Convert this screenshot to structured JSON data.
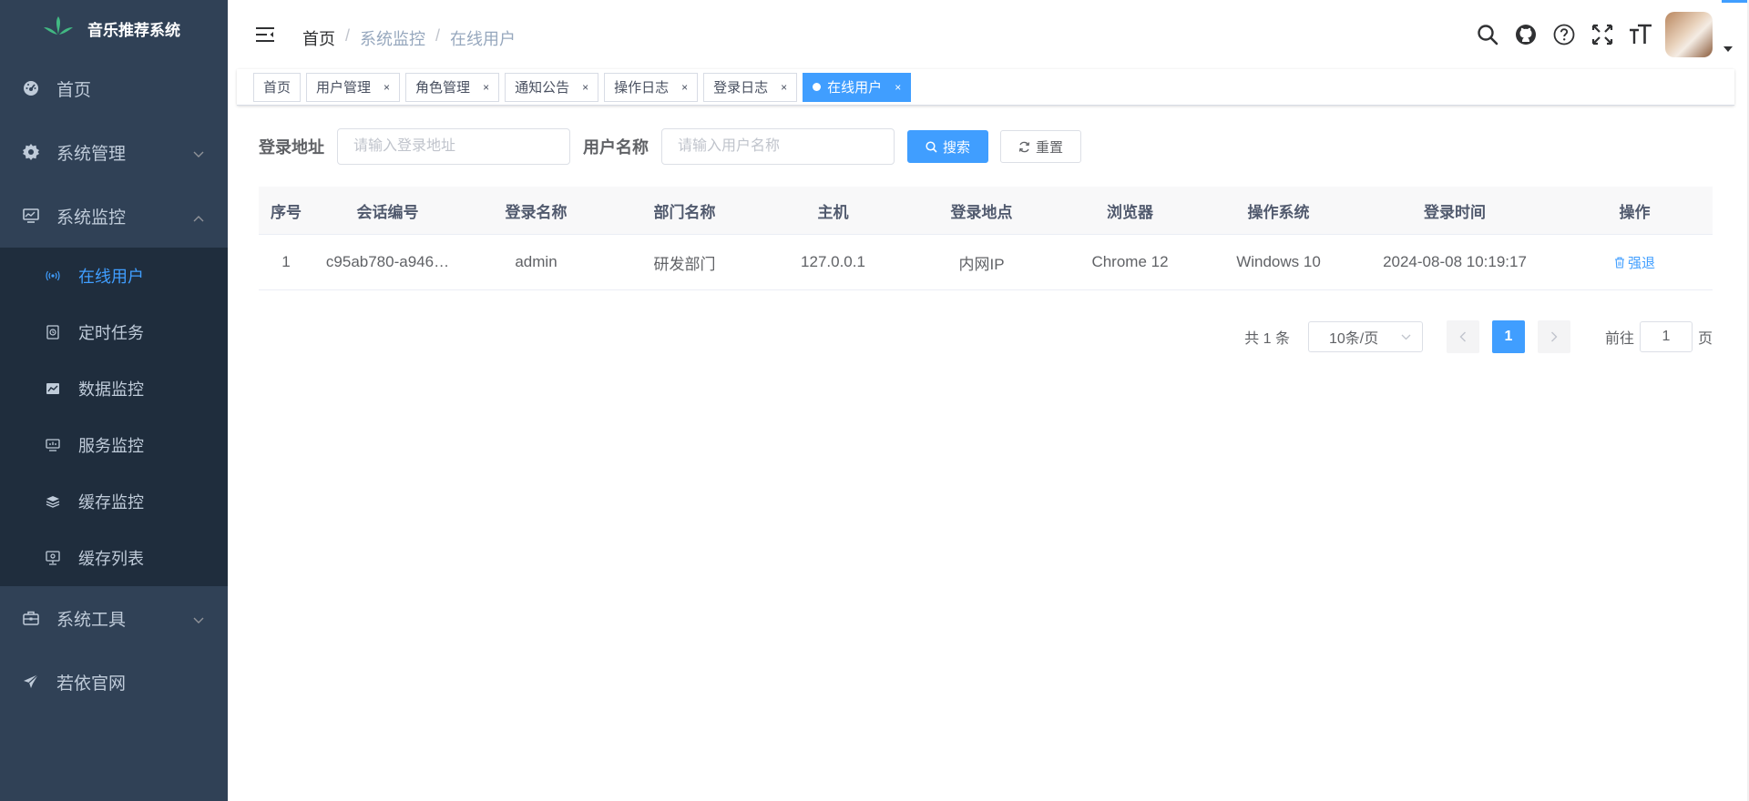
{
  "app": {
    "title": "音乐推荐系统"
  },
  "colors": {
    "sidebar_bg": "#304156",
    "sidebar_sub_bg": "#1f2d3d",
    "accent": "#409eff",
    "text": "#606266"
  },
  "sidebar": {
    "items": [
      {
        "label": "首页",
        "icon": "dashboard-icon"
      },
      {
        "label": "系统管理",
        "icon": "gear-icon",
        "expanded": false
      },
      {
        "label": "系统监控",
        "icon": "monitor-icon",
        "expanded": true
      },
      {
        "label": "系统工具",
        "icon": "toolbox-icon",
        "expanded": false
      },
      {
        "label": "若依官网",
        "icon": "paper-plane-icon"
      }
    ],
    "monitor_children": [
      {
        "label": "在线用户",
        "icon": "online-icon",
        "active": true
      },
      {
        "label": "定时任务",
        "icon": "job-icon"
      },
      {
        "label": "数据监控",
        "icon": "druid-icon"
      },
      {
        "label": "服务监控",
        "icon": "server-icon"
      },
      {
        "label": "缓存监控",
        "icon": "redis-icon"
      },
      {
        "label": "缓存列表",
        "icon": "redis-list-icon"
      }
    ]
  },
  "breadcrumb": {
    "items": [
      "首页",
      "系统监控",
      "在线用户"
    ],
    "separator": "/"
  },
  "navbar": {
    "icons": [
      "search-icon",
      "github-icon",
      "question-icon",
      "fullscreen-icon",
      "font-size-icon"
    ]
  },
  "tags": [
    {
      "label": "首页",
      "closable": false
    },
    {
      "label": "用户管理",
      "closable": true
    },
    {
      "label": "角色管理",
      "closable": true
    },
    {
      "label": "通知公告",
      "closable": true
    },
    {
      "label": "操作日志",
      "closable": true
    },
    {
      "label": "登录日志",
      "closable": true
    },
    {
      "label": "在线用户",
      "closable": true,
      "active": true
    }
  ],
  "tag_close_glyph": "×",
  "search_form": {
    "ipaddr_label": "登录地址",
    "ipaddr_placeholder": "请输入登录地址",
    "username_label": "用户名称",
    "username_placeholder": "请输入用户名称",
    "search_button": "搜索",
    "reset_button": "重置"
  },
  "table": {
    "columns": [
      "序号",
      "会话编号",
      "登录名称",
      "部门名称",
      "主机",
      "登录地点",
      "浏览器",
      "操作系统",
      "登录时间",
      "操作"
    ],
    "rows": [
      {
        "index": "1",
        "token": "c95ab780-a946…",
        "username": "admin",
        "dept": "研发部门",
        "host": "127.0.0.1",
        "location": "内网IP",
        "browser": "Chrome 12",
        "os": "Windows 10",
        "login_time": "2024-08-08 10:19:17",
        "action": "强退"
      }
    ]
  },
  "pagination": {
    "total_text": "共 1 条",
    "page_size": "10条/页",
    "current_page": "1",
    "goto_prefix": "前往",
    "goto_value": "1",
    "goto_suffix": "页"
  }
}
